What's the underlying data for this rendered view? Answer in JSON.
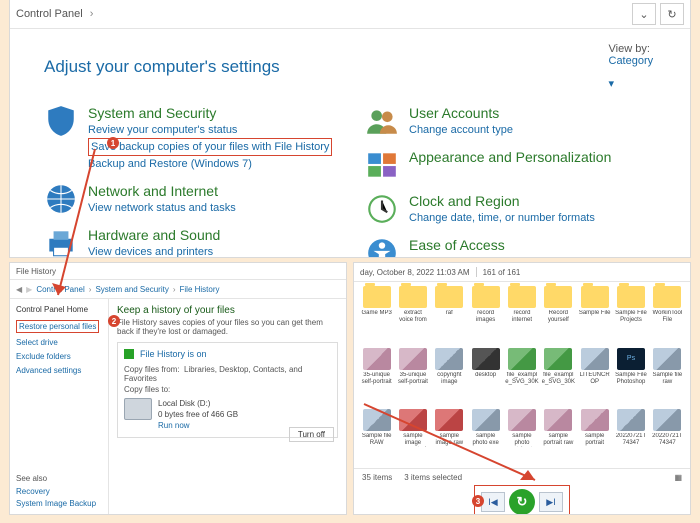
{
  "top": {
    "breadcrumb_root": "Control Panel",
    "title": "Adjust your computer's settings",
    "viewby_label": "View by:",
    "viewby_value": "Category",
    "refresh_icon": "↻",
    "left": [
      {
        "heading": "System and Security",
        "links": [
          "Review your computer's status",
          "Save backup copies of your files with File History",
          "Backup and Restore (Windows 7)"
        ],
        "highlight_index": 1
      },
      {
        "heading": "Network and Internet",
        "links": [
          "View network status and tasks"
        ]
      },
      {
        "heading": "Hardware and Sound",
        "links": [
          "View devices and printers"
        ]
      }
    ],
    "right": [
      {
        "heading": "User Accounts",
        "links": [
          "Change account type"
        ]
      },
      {
        "heading": "Appearance and Personalization",
        "links": []
      },
      {
        "heading": "Clock and Region",
        "links": [
          "Change date, time, or number formats"
        ]
      },
      {
        "heading": "Ease of Access",
        "links": []
      }
    ]
  },
  "fh": {
    "window_title": "File History",
    "crumbs": [
      "Control Panel",
      "System and Security",
      "File History"
    ],
    "side_home": "Control Panel Home",
    "side_links": [
      "Restore personal files",
      "Select drive",
      "Exclude folders",
      "Advanced settings"
    ],
    "side_highlight_index": 0,
    "see_also": "See also",
    "recovery": "Recovery",
    "sysimg": "System Image Backup",
    "main_title": "Keep a history of your files",
    "main_sub": "File History saves copies of your files so you can get them back if they're lost or damaged.",
    "on_label": "File History is on",
    "copy_from_label": "Copy files from:",
    "copy_from_value": "Libraries, Desktop, Contacts, and Favorites",
    "copy_to_label": "Copy files to:",
    "disk_name": "Local Disk (D:)",
    "disk_space": "0 bytes free of 466 GB",
    "run_now": "Run now",
    "turn_off": "Turn off"
  },
  "br": {
    "date": "day, October 8, 2022 11:03 AM",
    "count": "161 of 161",
    "items": [
      {
        "l": "Game MP3",
        "t": "folder"
      },
      {
        "l": "extract voice from photo",
        "t": "folder"
      },
      {
        "l": "raf",
        "t": "folder"
      },
      {
        "l": "record images",
        "t": "folder"
      },
      {
        "l": "record internet radio",
        "t": "folder"
      },
      {
        "l": "Record yourself drawing on",
        "t": "folder"
      },
      {
        "l": "Sample File",
        "t": "folder"
      },
      {
        "l": "Sample File Projects",
        "t": "folder"
      },
      {
        "l": "WorkinTool File Compress",
        "t": "folder"
      },
      {
        "l": "35-unique self-portrait",
        "t": "img2"
      },
      {
        "l": "35-unique self-portrait",
        "t": "img2"
      },
      {
        "l": "copyright image",
        "t": "img"
      },
      {
        "l": "desktop",
        "t": "img3"
      },
      {
        "l": "file_exampl e_SVG_30K",
        "t": "img5"
      },
      {
        "l": "file_exampl e_SVG_30K",
        "t": "img5"
      },
      {
        "l": "LITEUNCR OP",
        "t": "img"
      },
      {
        "l": "Sample File Photoshop",
        "t": "ps"
      },
      {
        "l": "Sample file raw",
        "t": "img"
      },
      {
        "l": "Sample file RAW",
        "t": "img"
      },
      {
        "l": "sample image converted",
        "t": "img4"
      },
      {
        "l": "sample image raw",
        "t": "img4"
      },
      {
        "l": "sample photo exe",
        "t": "img"
      },
      {
        "l": "sample photo matsimoto",
        "t": "img2"
      },
      {
        "l": "sample portrait raw",
        "t": "img2"
      },
      {
        "l": "sample portrait",
        "t": "img2"
      },
      {
        "l": "20220721T 74347",
        "t": "img"
      },
      {
        "l": "20220721T 74347",
        "t": "img"
      }
    ],
    "status_items": "35 items",
    "status_sel": "3 items selected",
    "prev": "I◀",
    "next": "▶I",
    "restore": "↻"
  },
  "badges": {
    "b1": "1",
    "b2": "2",
    "b3": "3"
  }
}
